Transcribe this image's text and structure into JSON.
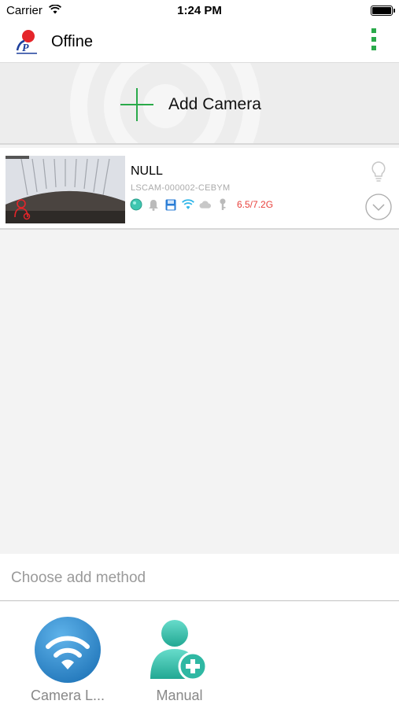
{
  "status_bar": {
    "carrier": "Carrier",
    "time": "1:24 PM"
  },
  "nav": {
    "title": "Offine",
    "logo_icon": "app-logo",
    "menu_icon": "more-vertical-icon"
  },
  "add_camera": {
    "label": "Add Camera",
    "accent": "#2aaa4a"
  },
  "cameras": [
    {
      "name": "NULL",
      "uid": "LSCAM-000002-CEBYM",
      "storage": "6.5/7.2G",
      "status_color": "#3ec6b0"
    }
  ],
  "sheet": {
    "title": "Choose add method",
    "options": [
      {
        "label": "Camera L...",
        "icon": "wifi-icon",
        "color": "#2b8bd0"
      },
      {
        "label": "Manual",
        "icon": "add-user-icon",
        "color": "#3cc8b4"
      }
    ]
  }
}
